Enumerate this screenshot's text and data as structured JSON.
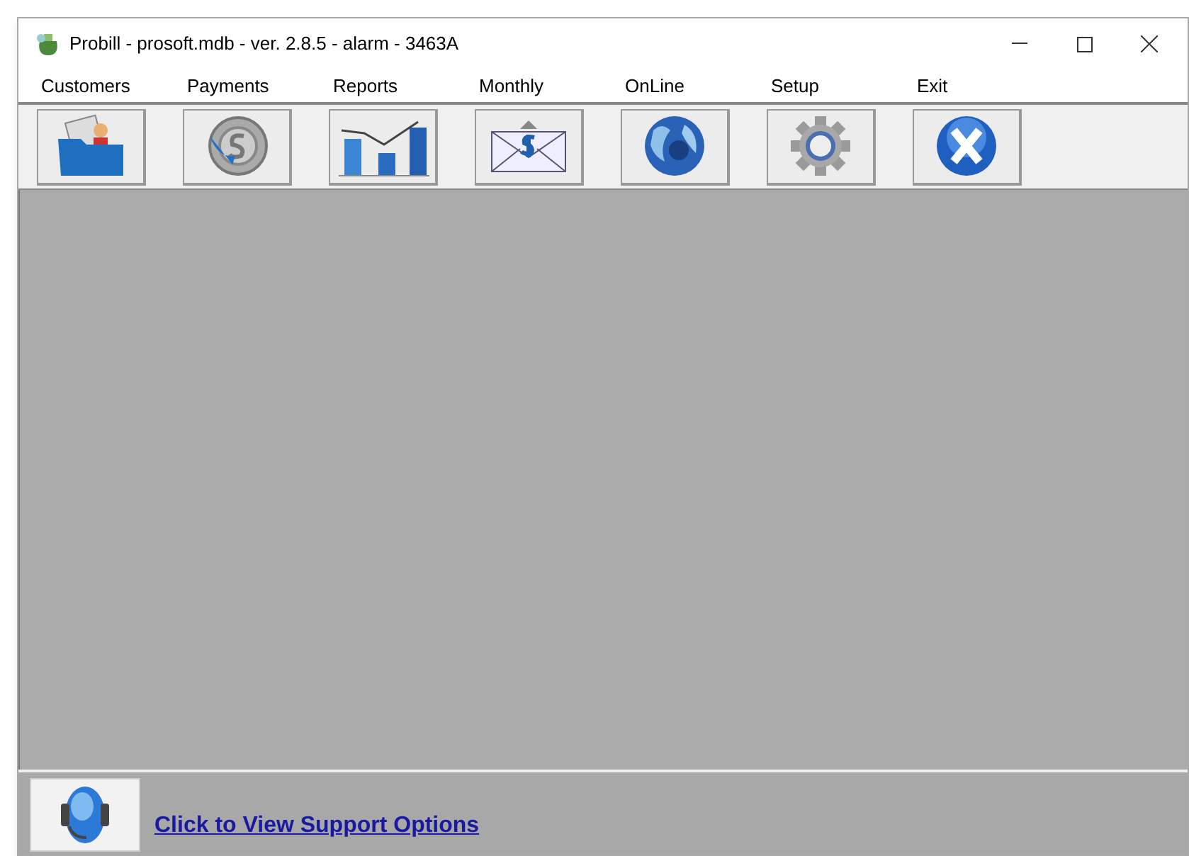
{
  "window": {
    "title": "Probill - prosoft.mdb - ver. 2.8.5 - alarm - 3463A"
  },
  "menu": [
    "Customers",
    "Payments",
    "Reports",
    "Monthly",
    "OnLine",
    "Setup",
    "Exit"
  ],
  "toolbar": [
    {
      "kind": "folder"
    },
    {
      "kind": "payment"
    },
    {
      "kind": "chart"
    },
    {
      "kind": "envelope"
    },
    {
      "kind": "globe"
    },
    {
      "kind": "gear"
    },
    {
      "kind": "exit"
    }
  ],
  "support": {
    "link": "Click to View Support Options"
  }
}
